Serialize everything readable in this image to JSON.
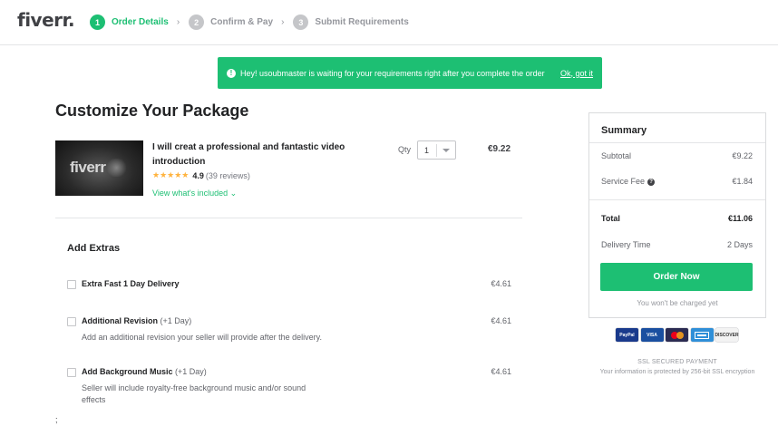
{
  "header": {
    "logo": "fiverr",
    "steps": [
      {
        "num": "1",
        "label": "Order Details",
        "active": true
      },
      {
        "num": "2",
        "label": "Confirm & Pay",
        "active": false
      },
      {
        "num": "3",
        "label": "Submit Requirements",
        "active": false
      }
    ],
    "separator": "›"
  },
  "banner": {
    "message": "Hey! usoubmaster is waiting for your requirements right after you complete the order",
    "action": "Ok, got it"
  },
  "main": {
    "title": "Customize Your Package",
    "gig": {
      "thumbnail_text": "fiverr",
      "title": "I will creat a professional and fantastic video introduction",
      "stars": "★★★★★",
      "score": "4.9",
      "reviews": "(39 reviews)",
      "view_included": "View what's included",
      "qty_label": "Qty",
      "qty_value": "1",
      "price": "€9.22"
    },
    "extras_title": "Add Extras",
    "extras": [
      {
        "name": "Extra Fast 1 Day Delivery",
        "note": "",
        "desc": "",
        "price": "€4.61"
      },
      {
        "name": "Additional Revision",
        "note": "(+1 Day)",
        "desc": "Add an additional revision your seller will provide after the delivery.",
        "price": "€4.61"
      },
      {
        "name": "Add Background Music",
        "note": "(+1 Day)",
        "desc": "Seller will include royalty-free background music and/or sound effects",
        "price": "€4.61"
      }
    ],
    "stray_char": ";"
  },
  "summary": {
    "title": "Summary",
    "subtotal_label": "Subtotal",
    "subtotal_value": "€9.22",
    "service_fee_label": "Service Fee",
    "service_fee_value": "€1.84",
    "total_label": "Total",
    "total_value": "€11.06",
    "delivery_label": "Delivery Time",
    "delivery_value": "2 Days",
    "order_button": "Order Now",
    "not_charged": "You won't be charged yet"
  },
  "payment": {
    "cards": [
      "PayPal",
      "VISA",
      "",
      "",
      "DISCOVER"
    ],
    "ssl_title": "SSL SECURED PAYMENT",
    "ssl_desc": "Your information is protected by 256-bit SSL encryption"
  },
  "colors": {
    "accent": "#1dbf73",
    "text": "#222325",
    "muted": "#62646a"
  }
}
